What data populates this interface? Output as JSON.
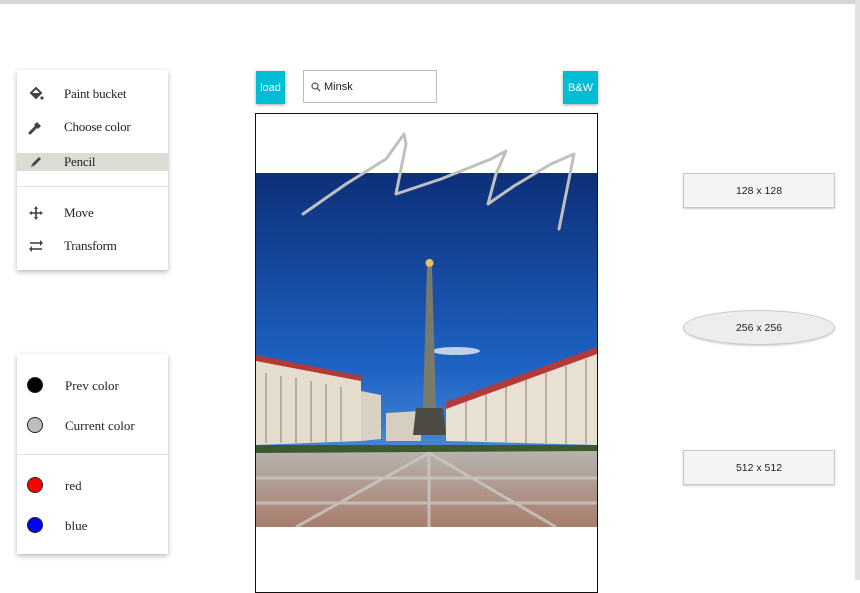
{
  "tools": {
    "items": [
      {
        "label": "Paint bucket",
        "icon": "paint-bucket-icon"
      },
      {
        "label": "Choose color",
        "icon": "eyedropper-icon"
      },
      {
        "label": "Pencil",
        "icon": "pencil-icon",
        "selected": true
      },
      {
        "label": "Move",
        "icon": "move-icon"
      },
      {
        "label": "Transform",
        "icon": "transform-icon"
      }
    ]
  },
  "colors": {
    "prev": {
      "label": "Prev color",
      "color": "#000000"
    },
    "current": {
      "label": "Current color",
      "color": "#bdbdbd"
    },
    "swatches": [
      {
        "label": "red",
        "color": "#ff0000"
      },
      {
        "label": "blue",
        "color": "#0000ff"
      }
    ]
  },
  "toolbar": {
    "load_label": "load",
    "bw_label": "B&W",
    "search_value": "Minsk",
    "accent": "#00bcd4"
  },
  "sizes": {
    "s128": "128 x 128",
    "s256": "256 x 256",
    "s512": "512 x 512"
  }
}
